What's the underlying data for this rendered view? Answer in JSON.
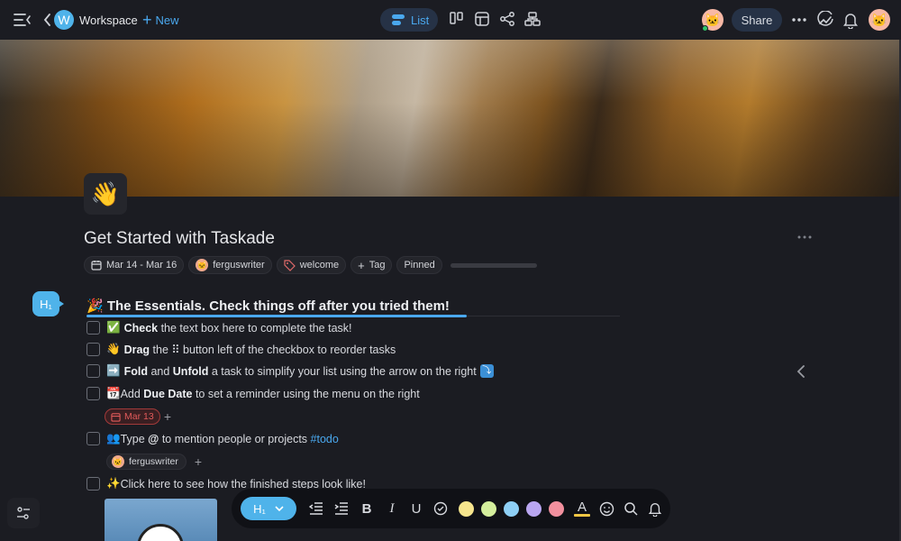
{
  "topbar": {
    "workspace_initial": "W",
    "workspace_label": "Workspace",
    "new_label": "New",
    "view_list_label": "List",
    "share_label": "Share",
    "avatar_emoji": "🐱"
  },
  "page": {
    "emoji": "👋",
    "title": "Get Started with Taskade",
    "date_range": "Mar 14 - Mar 16",
    "owner": "ferguswriter",
    "tag": "welcome",
    "add_tag_label": "Tag",
    "pinned_label": "Pinned",
    "progress_fraction": 0.0
  },
  "heading": {
    "badge": "H₁",
    "emoji": "🎉",
    "text": "The Essentials. Check things off after you tried them!"
  },
  "tasks": [
    {
      "emoji": "✅",
      "bold1": "Check",
      "rest1": " the text box here to complete the task!"
    },
    {
      "emoji": "👋",
      "bold1": "Drag",
      "rest1": " the ⠿ button left of the checkbox to reorder tasks"
    },
    {
      "emoji": "➡️",
      "bold1": "Fold",
      "mid": " and ",
      "bold2": "Unfold",
      "rest2": " a task to simplify your list using the arrow on the right",
      "trailing_glyph": "⤵"
    },
    {
      "emoji": "📆",
      "pre": "Add ",
      "bold1": "Due Date",
      "rest1": " to set a reminder using the menu on the right",
      "due": "Mar 13"
    },
    {
      "emoji": "👥",
      "pre": "Type ",
      "bold1": "@",
      "rest1": " to mention people or projects ",
      "hashtag": "#todo",
      "assignee": "ferguswriter"
    },
    {
      "emoji": "✨",
      "pre": "Click here to see how the finished steps look like!"
    }
  ],
  "toolbar": {
    "heading_label": "H₁",
    "bold": "B",
    "italic": "I",
    "underline": "U",
    "text_color_label": "A",
    "swatches": [
      "#f6e58d",
      "#d4ee9c",
      "#8ecff5",
      "#b9a6f0",
      "#f2909e"
    ]
  }
}
